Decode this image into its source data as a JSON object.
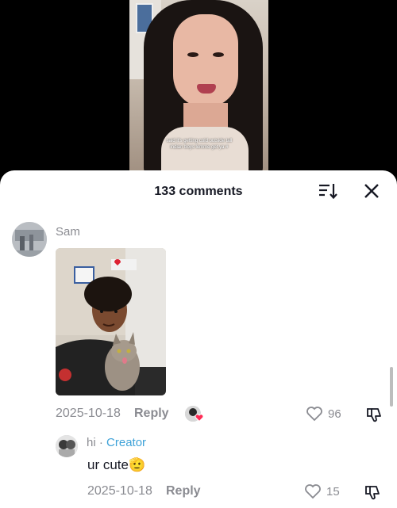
{
  "video": {
    "caption_line1": "said it's getting cold outside tall",
    "caption_line2": "indian boys lemme get ya #"
  },
  "header": {
    "count_label": "133 comments",
    "sort_icon": "sort-icon",
    "close_icon": "close-icon"
  },
  "comments": [
    {
      "username": "Sam",
      "date": "2025-10-18",
      "reply_label": "Reply",
      "likes": "96",
      "has_photo": true
    },
    {
      "username": "hi",
      "separator": " · ",
      "badge": "Creator",
      "text": "ur cute🫡",
      "date": "2025-10-18",
      "reply_label": "Reply",
      "likes": "15"
    }
  ],
  "colors": {
    "accent": "#3ea2d8",
    "muted": "#8a8b91",
    "text": "#161823"
  }
}
